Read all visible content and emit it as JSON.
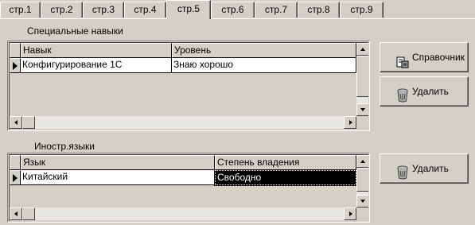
{
  "tabs": [
    {
      "label": "стр.1",
      "active": false
    },
    {
      "label": "стр.2",
      "active": false
    },
    {
      "label": "стр.3",
      "active": false
    },
    {
      "label": "стр.4",
      "active": false
    },
    {
      "label": "стр.5",
      "active": true
    },
    {
      "label": "стр.6",
      "active": false
    },
    {
      "label": "стр.7",
      "active": false
    },
    {
      "label": "стр.8",
      "active": false
    },
    {
      "label": "стр.9",
      "active": false
    }
  ],
  "skills": {
    "group_label": "Специальные навыки",
    "columns": [
      "Навык",
      "Уровень"
    ],
    "rows": [
      [
        "Конфигурирование 1С",
        "Знаю хорошо"
      ]
    ],
    "reference_button": "Справочник",
    "delete_button": "Удалить"
  },
  "languages": {
    "group_label": "Иностр.языки",
    "columns": [
      "Язык",
      "Степень владения"
    ],
    "rows": [
      [
        "Китайский",
        "Свободно"
      ]
    ],
    "delete_button": "Удалить"
  },
  "icons": {
    "reference": "reference-book-icon",
    "delete": "recycle-bin-icon"
  },
  "colors": {
    "face": "#d4d0c8",
    "selection": "#000000"
  }
}
